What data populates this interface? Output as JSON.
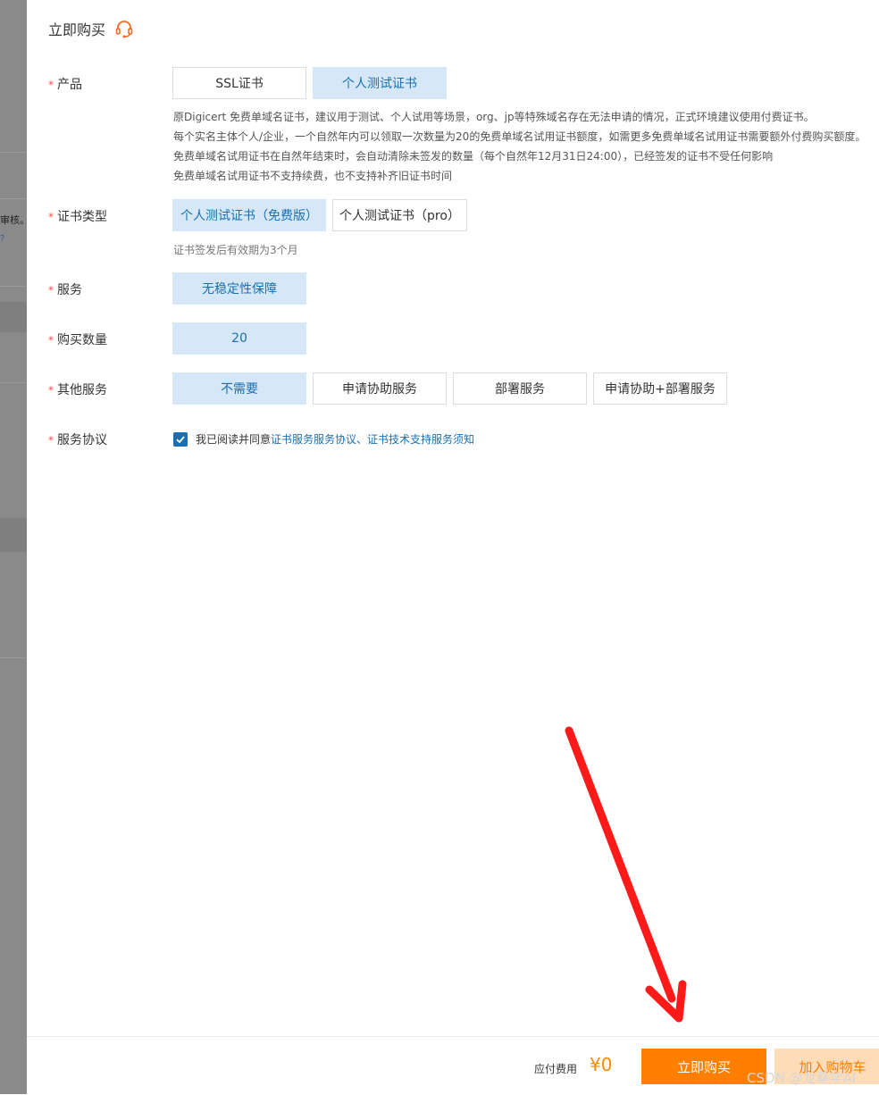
{
  "background": {
    "review_text": "审核。",
    "help_glyph": "?"
  },
  "drawer": {
    "title": "立即购买",
    "required_mark": "*"
  },
  "form": {
    "product": {
      "label": "产品",
      "options": [
        "SSL证书",
        "个人测试证书"
      ],
      "selected": "个人测试证书",
      "description": [
        "原Digicert 免费单域名证书，建议用于测试、个人试用等场景，org、jp等特殊域名存在无法申请的情况，正式环境建议使用付费证书。",
        "每个实名主体个人/企业，一个自然年内可以领取一次数量为20的免费单域名试用证书额度，如需更多免费单域名试用证书需要额外付费购买额度。",
        "免费单域名试用证书在自然年结束时，会自动清除未签发的数量（每个自然年12月31日24:00），已经签发的证书不受任何影响",
        "免费单域名试用证书不支持续费，也不支持补齐旧证书时间"
      ]
    },
    "cert_type": {
      "label": "证书类型",
      "options": [
        "个人测试证书（免费版）",
        "个人测试证书（pro）"
      ],
      "selected": "个人测试证书（免费版）",
      "hint": "证书签发后有效期为3个月"
    },
    "service": {
      "label": "服务",
      "options": [
        "无稳定性保障"
      ],
      "selected": "无稳定性保障"
    },
    "quantity": {
      "label": "购买数量",
      "value": "20"
    },
    "other_services": {
      "label": "其他服务",
      "options": [
        "不需要",
        "申请协助服务",
        "部署服务",
        "申请协助+部署服务"
      ],
      "selected": "不需要"
    },
    "agreement": {
      "label": "服务协议",
      "checked": true,
      "prefix": "我已阅读并同意",
      "link1": "证书服务服务协议",
      "separator": "、",
      "link2": "证书技术支持服务须知"
    }
  },
  "footer": {
    "fee_label": "应付费用",
    "fee_value": "¥0",
    "buy_label": "立即购买",
    "cart_label": "加入购物车"
  },
  "watermark": "CSDN @龙桑学AI",
  "colors": {
    "accent": "#1a6fb0",
    "selected_bg": "#d6e8f7",
    "orange": "#ff7f00",
    "required": "#ff4d4f",
    "annotation_arrow": "#ff1a1a"
  },
  "icons": {
    "title_icon": "headset-icon",
    "check_icon": "checkmark-icon"
  }
}
